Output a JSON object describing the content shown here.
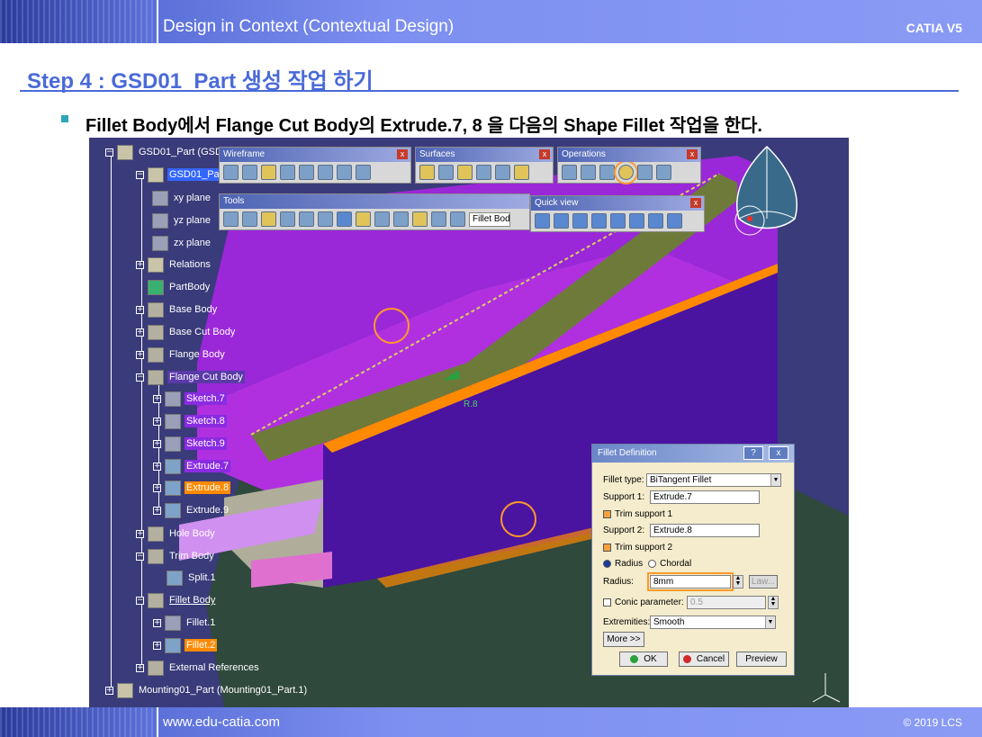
{
  "header": {
    "title": "Design in Context (Contextual Design)",
    "brand": "CATIA V5"
  },
  "step_title": "Step 4 : GSD01_Part 생성 작업 하기",
  "instruction": "Fillet Body에서  Flange Cut Body의 Extrude.7, 8 을 다음의 Shape Fillet 작업을 한다.",
  "tree": {
    "root_label": "GSD01_Part (GSD",
    "items": [
      {
        "label": "GSD01_Part"
      },
      {
        "label": "xy plane"
      },
      {
        "label": "yz plane"
      },
      {
        "label": "zx plane"
      },
      {
        "label": "Relations"
      },
      {
        "label": "PartBody"
      },
      {
        "label": "Base Body"
      },
      {
        "label": "Base Cut Body"
      },
      {
        "label": "Flange Body"
      },
      {
        "label": "Flange Cut Body"
      },
      {
        "label": "Sketch.7"
      },
      {
        "label": "Sketch.8"
      },
      {
        "label": "Sketch.9"
      },
      {
        "label": "Extrude.7"
      },
      {
        "label": "Extrude.8"
      },
      {
        "label": "Extrude.9"
      },
      {
        "label": "Hole Body"
      },
      {
        "label": "Trim Body"
      },
      {
        "label": "Split.1"
      },
      {
        "label": "Fillet Body"
      },
      {
        "label": "Fillet.1"
      },
      {
        "label": "Fillet.2"
      },
      {
        "label": "External References"
      },
      {
        "label": "Mounting01_Part (Mounting01_Part.1)"
      }
    ]
  },
  "toolbars": {
    "wireframe": "Wireframe",
    "surfaces": "Surfaces",
    "operations": "Operations",
    "tools": "Tools",
    "tools_field": "Fillet Bod",
    "quick_view": "Quick view",
    "close_glyph": "x"
  },
  "viewport_label": "R.8",
  "dialog": {
    "title": "Fillet Definition",
    "help_glyph": "?",
    "close_glyph": "x",
    "fillet_type_label": "Fillet type:",
    "fillet_type_value": "BiTangent Fillet",
    "support1_label": "Support 1:",
    "support1_value": "Extrude.7",
    "trim1_label": "Trim support 1",
    "support2_label": "Support 2:",
    "support2_value": "Extrude.8",
    "trim2_label": "Trim support 2",
    "radius_option": "Radius",
    "chordal_option": "Chordal",
    "radius_label": "Radius:",
    "radius_value": "8mm",
    "law_button": "Law...",
    "conic_label": "Conic parameter:",
    "conic_value": "0.5",
    "extremities_label": "Extremities:",
    "extremities_value": "Smooth",
    "more_button": "More >>",
    "ok_button": "OK",
    "cancel_button": "Cancel",
    "preview_button": "Preview"
  },
  "footer": {
    "url": "www.edu-catia.com",
    "copyright": "© 2019 LCS"
  },
  "colors": {
    "header_blue": "#5a6fd8",
    "title_blue": "#4a6ad8",
    "viewport_bg": "#3a3b7a",
    "highlight_orange": "#ff8a00",
    "highlight_purple": "#8a2be2"
  }
}
